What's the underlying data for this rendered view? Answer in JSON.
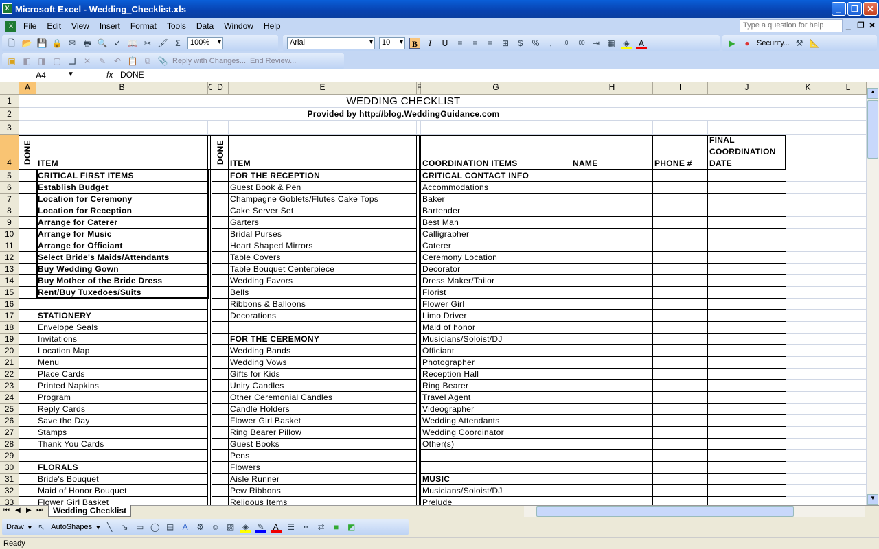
{
  "window": {
    "title": "Microsoft Excel - Wedding_Checklist.xls"
  },
  "menu": [
    "File",
    "Edit",
    "View",
    "Insert",
    "Format",
    "Tools",
    "Data",
    "Window",
    "Help"
  ],
  "help_placeholder": "Type a question for help",
  "toolbar": {
    "zoom": "100%",
    "font": "Arial",
    "font_size": "10",
    "bold": "B",
    "italic": "I",
    "underline": "U",
    "currency": "$",
    "percent": "%",
    "comma": ",",
    "sum": "Σ",
    "security": "Security...",
    "reply": "Reply with Changes...",
    "end_review": "End Review..."
  },
  "formula": {
    "cell": "A4",
    "fx": "fx",
    "value": "DONE"
  },
  "columns": [
    "A",
    "B",
    "C",
    "D",
    "E",
    "F",
    "G",
    "H",
    "I",
    "J",
    "K",
    "L"
  ],
  "sheet": {
    "title": "WEDDING CHECKLIST",
    "subtitle": "Provided by http://blog.WeddingGuidance.com",
    "headers": {
      "done1": "DONE",
      "item1": "ITEM",
      "done2": "DONE",
      "item2": "ITEM",
      "coord": "COORDINATION ITEMS",
      "name": "NAME",
      "phone": "PHONE #",
      "final": "FINAL COORDINATION DATE"
    },
    "rows": [
      {
        "n": 5,
        "b": "CRITICAL FIRST ITEMS",
        "e": "FOR THE RECEPTION",
        "g": "CRITICAL CONTACT INFO",
        "bold": "beg"
      },
      {
        "n": 6,
        "b": "Establish Budget",
        "e": "Guest Book & Pen",
        "g": "Accommodations",
        "bold": "b"
      },
      {
        "n": 7,
        "b": "Location for Ceremony",
        "e": "Champagne Goblets/Flutes Cake Tops",
        "g": "Baker",
        "bold": "b"
      },
      {
        "n": 8,
        "b": "Location for Reception",
        "e": "Cake Server Set",
        "g": "Bartender",
        "bold": "b"
      },
      {
        "n": 9,
        "b": "Arrange for Caterer",
        "e": "Garters",
        "g": "Best Man",
        "bold": "b"
      },
      {
        "n": 10,
        "b": "Arrange for Music",
        "e": "Bridal Purses",
        "g": "Calligrapher",
        "bold": "b"
      },
      {
        "n": 11,
        "b": "Arrange for Officiant",
        "e": "Heart Shaped Mirrors",
        "g": "Caterer",
        "bold": "b"
      },
      {
        "n": 12,
        "b": "Select Bride's Maids/Attendants",
        "e": "Table Covers",
        "g": "Ceremony Location",
        "bold": "b"
      },
      {
        "n": 13,
        "b": "Buy Wedding Gown",
        "e": "Table Bouquet Centerpiece",
        "g": "Decorator",
        "bold": "b"
      },
      {
        "n": 14,
        "b": "Buy Mother of the Bride Dress",
        "e": "Wedding Favors",
        "g": "Dress Maker/Tailor",
        "bold": "b"
      },
      {
        "n": 15,
        "b": "Rent/Buy Tuxedoes/Suits",
        "e": "Bells",
        "g": "Florist",
        "bold": "b"
      },
      {
        "n": 16,
        "b": "",
        "e": "Ribbons & Balloons",
        "g": "Flower Girl",
        "bold": ""
      },
      {
        "n": 17,
        "b": " STATIONERY",
        "e": "Decorations",
        "g": "Limo Driver",
        "bold": "b"
      },
      {
        "n": 18,
        "b": "Envelope Seals",
        "e": "",
        "g": "Maid of honor",
        "bold": ""
      },
      {
        "n": 19,
        "b": "Invitations",
        "e": "FOR THE CEREMONY",
        "g": "Musicians/Soloist/DJ",
        "bold": "e"
      },
      {
        "n": 20,
        "b": "Location Map",
        "e": "Wedding Bands",
        "g": "Officiant",
        "bold": ""
      },
      {
        "n": 21,
        "b": "Menu",
        "e": "Wedding Vows",
        "g": "Photographer",
        "bold": ""
      },
      {
        "n": 22,
        "b": "Place Cards",
        "e": "Gifts for Kids",
        "g": "Reception Hall",
        "bold": ""
      },
      {
        "n": 23,
        "b": "Printed Napkins",
        "e": "Unity Candles",
        "g": "Ring Bearer",
        "bold": ""
      },
      {
        "n": 24,
        "b": "Program",
        "e": "Other Ceremonial Candles",
        "g": "Travel Agent",
        "bold": ""
      },
      {
        "n": 25,
        "b": "Reply Cards",
        "e": "Candle Holders",
        "g": "Videographer",
        "bold": ""
      },
      {
        "n": 26,
        "b": "Save the Day",
        "e": "Flower Girl Basket",
        "g": "Wedding Attendants",
        "bold": ""
      },
      {
        "n": 27,
        "b": "Stamps",
        "e": "Ring Bearer Pillow",
        "g": "Wedding Coordinator",
        "bold": ""
      },
      {
        "n": 28,
        "b": "Thank You Cards",
        "e": "Guest Books",
        "g": "Other(s)",
        "bold": ""
      },
      {
        "n": 29,
        "b": "",
        "e": "Pens",
        "g": "",
        "bold": ""
      },
      {
        "n": 30,
        "b": "FLORALS",
        "e": "Flowers",
        "g": "",
        "bold": "b"
      },
      {
        "n": 31,
        "b": "Bride's Bouquet",
        "e": "Aisle Runner",
        "g": "MUSIC",
        "bold": "g"
      },
      {
        "n": 32,
        "b": "Maid of Honor Bouquet",
        "e": "Pew Ribbons",
        "g": "Musicians/Soloist/DJ",
        "bold": ""
      },
      {
        "n": 33,
        "b": "Flower Girl Basket",
        "e": "Religous Items",
        "g": "Prelude",
        "bold": ""
      }
    ]
  },
  "sheet_tab": "Wedding Checklist",
  "drawbar": {
    "draw": "Draw",
    "autoshapes": "AutoShapes"
  },
  "status": "Ready"
}
